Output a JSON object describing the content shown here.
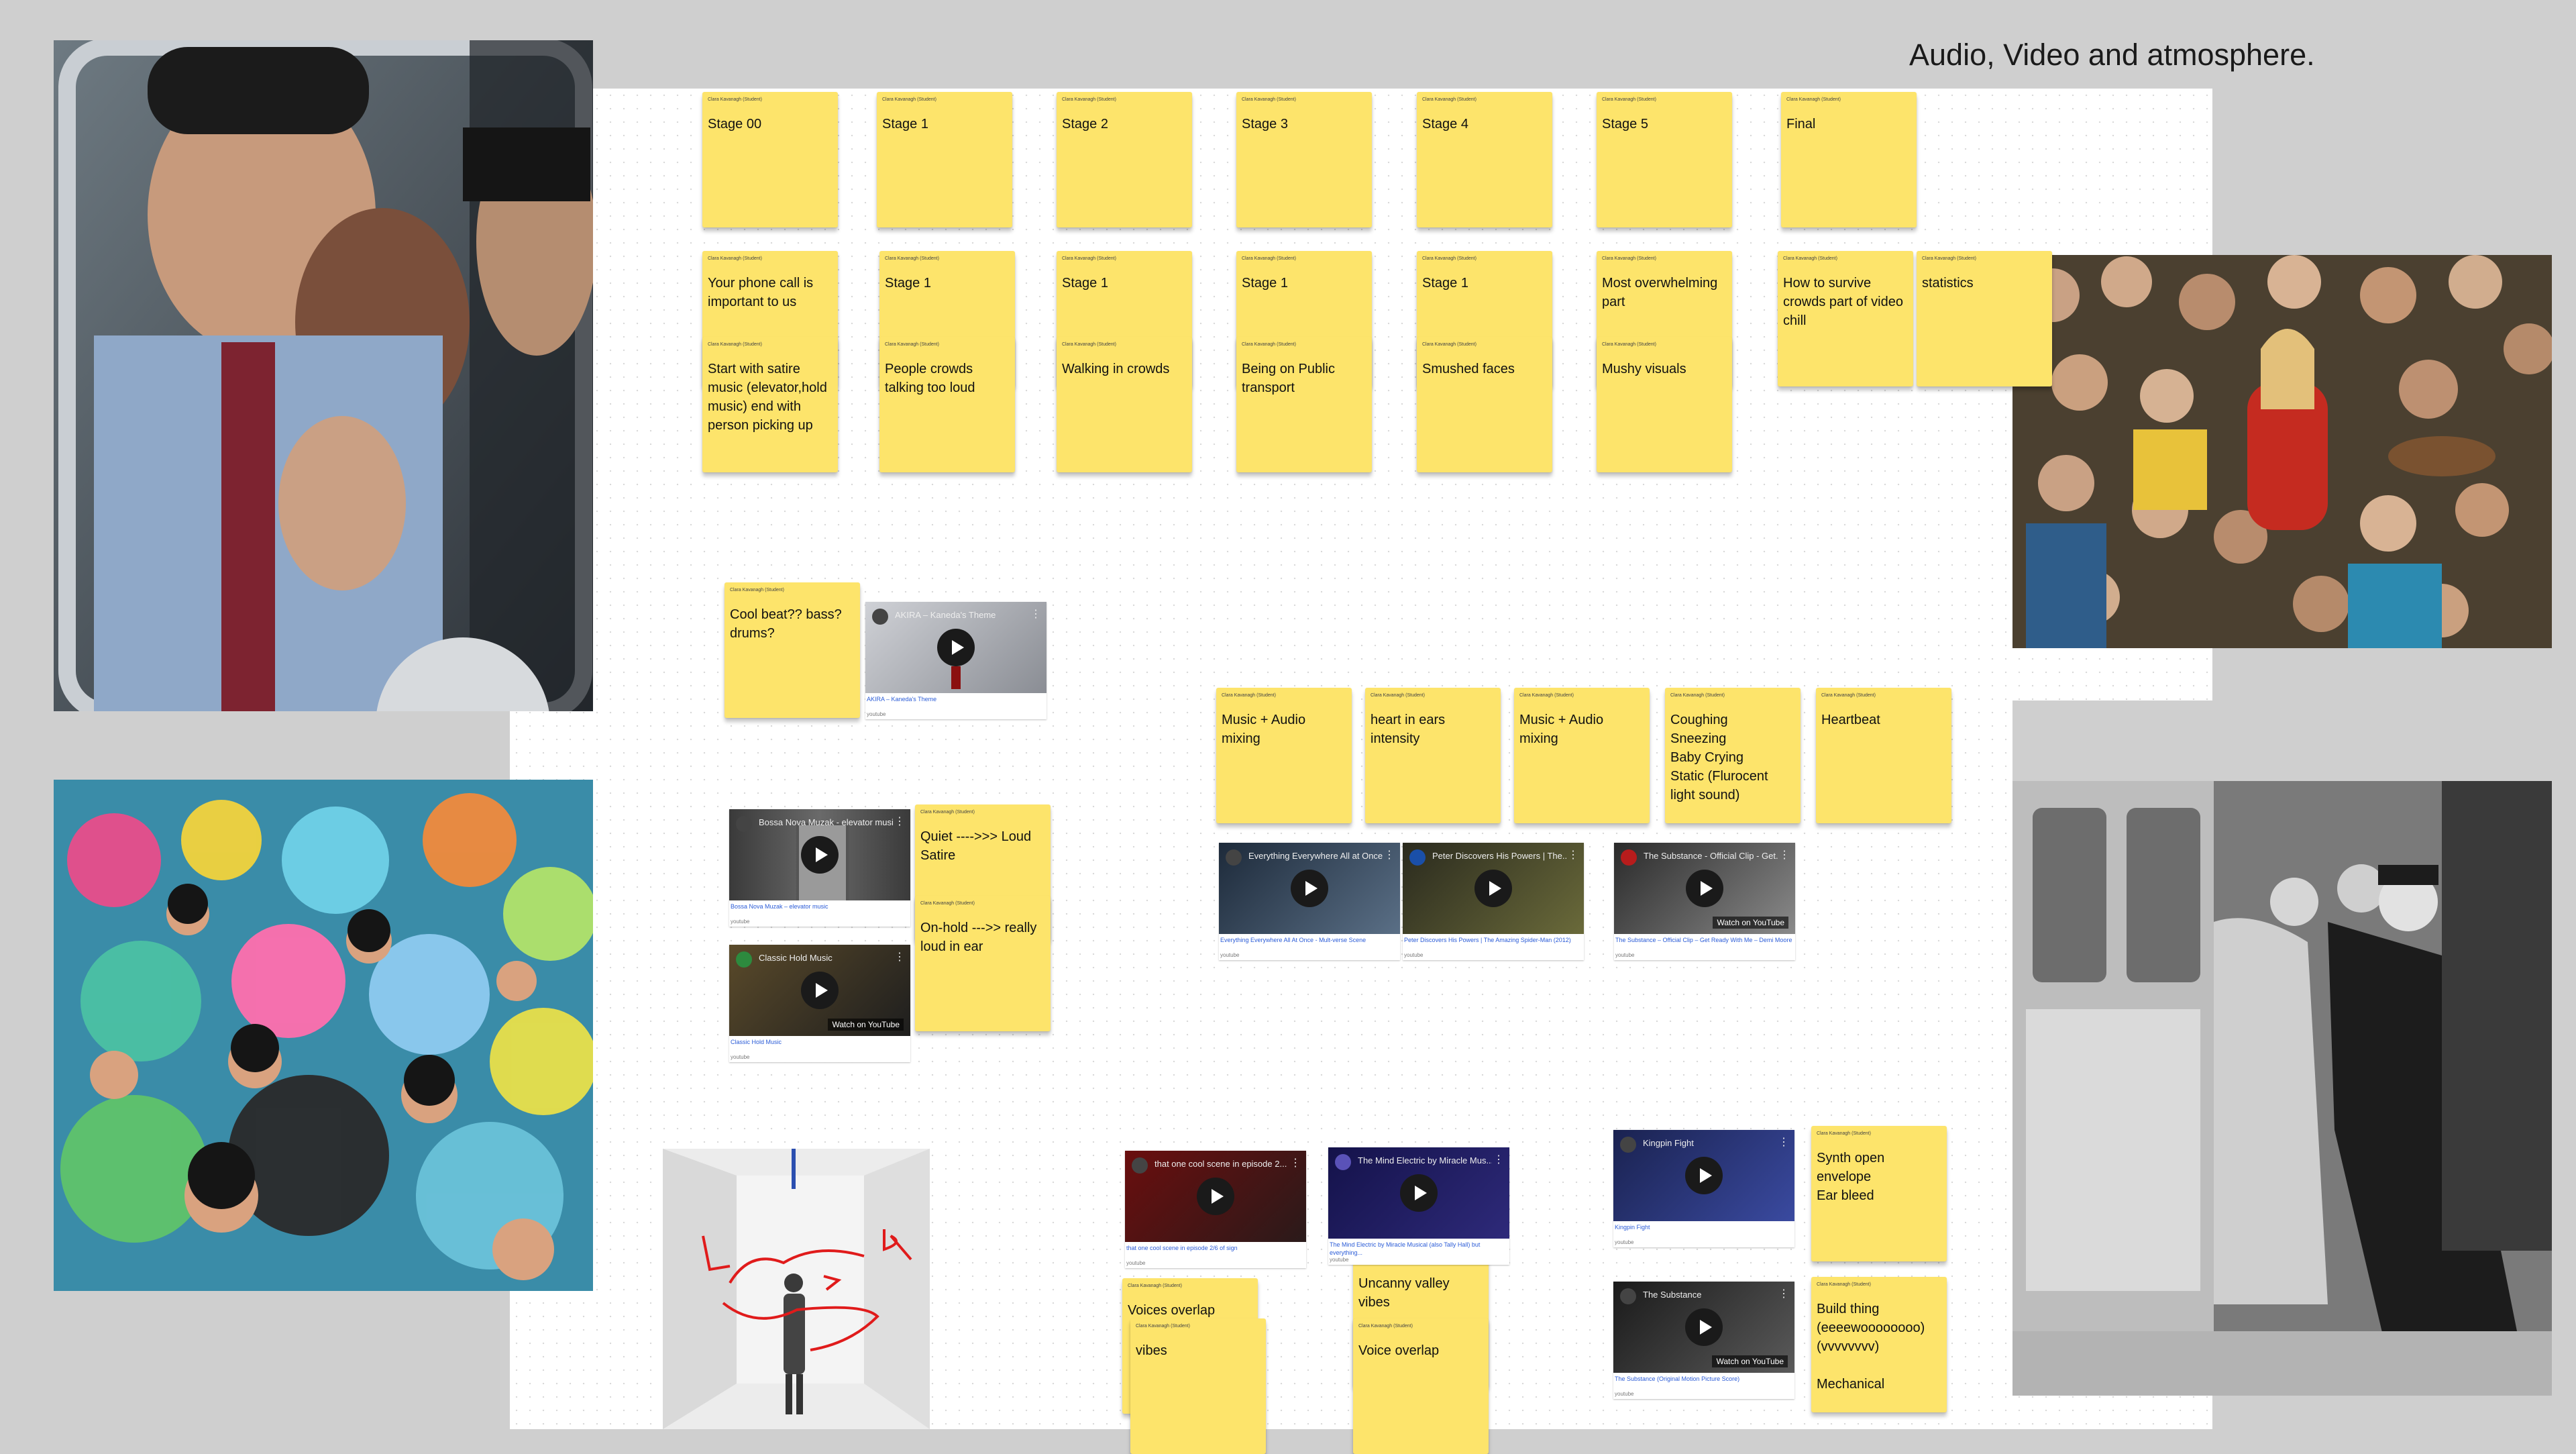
{
  "title": "Audio, Video and atmosphere.",
  "author": "Clara Kavanagh (Student)",
  "notes": [
    {
      "text": "Stage 00"
    },
    {
      "text": "Stage 1"
    },
    {
      "text": "Stage 2"
    },
    {
      "text": "Stage 3"
    },
    {
      "text": "Stage 4"
    },
    {
      "text": "Stage 5"
    },
    {
      "text": "Final"
    },
    {
      "text": "Your phone call is important to us"
    },
    {
      "text": "Stage 1"
    },
    {
      "text": "Stage 1"
    },
    {
      "text": "Stage 1"
    },
    {
      "text": "Stage 1"
    },
    {
      "text": "Most overwhelming part"
    },
    {
      "text": "How to survive crowds part of video chill"
    },
    {
      "text": "statistics"
    },
    {
      "text": "Start with satire music (elevator,hold music) end with person picking up"
    },
    {
      "text": "People crowds talking too loud"
    },
    {
      "text": "Walking in crowds"
    },
    {
      "text": "Being on Public transport"
    },
    {
      "text": "Smushed faces"
    },
    {
      "text": "Mushy visuals"
    },
    {
      "text": "Cool beat?? bass? drums?"
    },
    {
      "text": "Music + Audio mixing"
    },
    {
      "text": "heart in ears intensity"
    },
    {
      "text": "Music + Audio mixing"
    },
    {
      "text": "Coughing\nSneezing\nBaby Crying\nStatic (Flurocent light sound)"
    },
    {
      "text": "Heartbeat"
    },
    {
      "text": "Quiet ---->>> Loud Satire"
    },
    {
      "text": "On-hold --->> really loud in ear"
    },
    {
      "text": "Synth open envelope\nEar bleed"
    },
    {
      "text": "Build thing (eeeewoooooooo) (vvvvvvvv)\n\nMechanical"
    },
    {
      "text": "Uncanny valley vibes"
    },
    {
      "text": "Voice overlap"
    },
    {
      "text": "Voices overlap"
    },
    {
      "text": "vibes"
    }
  ],
  "videos": [
    {
      "title": "AKIRA – Kaneda's Theme",
      "caption": "AKIRA – Kaneda's Theme",
      "source": "youtube",
      "badge": ""
    },
    {
      "title": "Bossa Nova Muzak - elevator music",
      "caption": "Bossa Nova Muzak – elevator music",
      "source": "youtube",
      "badge": ""
    },
    {
      "title": "Classic Hold Music",
      "caption": "Classic Hold Music",
      "source": "youtube",
      "badge": "Watch on YouTube"
    },
    {
      "title": "Everything Everywhere All at Once",
      "caption": "Everything Everywhere All At Once - Mult-verse Scene",
      "source": "youtube",
      "badge": ""
    },
    {
      "title": "Peter Discovers His Powers | The...",
      "caption": "Peter Discovers His Powers | The Amazing Spider-Man (2012)",
      "source": "youtube",
      "badge": ""
    },
    {
      "title": "The Substance - Official Clip - Get...",
      "caption": "The Substance – Official Clip – Get Ready With Me – Demi Moore",
      "source": "youtube",
      "badge": "Watch on YouTube"
    },
    {
      "title": "that one cool scene in episode 2...",
      "caption": "that one cool scene in episode 2/6 of sign",
      "source": "youtube",
      "badge": ""
    },
    {
      "title": "The Mind Electric by Miracle Mus...",
      "caption": "The Mind Electric by Miracle Musical (also Tally Hall) but everything...",
      "source": "youtube",
      "badge": ""
    },
    {
      "title": "Kingpin Fight",
      "caption": "Kingpin Fight",
      "source": "youtube",
      "badge": ""
    },
    {
      "title": "The Substance",
      "caption": "The Substance (Original Motion Picture Score)",
      "source": "youtube",
      "badge": "Watch on YouTube"
    }
  ],
  "photos": {
    "subway_window": "Commuter pressed against wet train window",
    "pool": "Crowded pool with inflatable rings",
    "crowd": "Overhead view of a dense crowd of people",
    "train_pusher": "Black and white photo of station attendant pushing passengers into a train",
    "room_sketch": "White room with hanging cable, person and red annotation",
    "sketch_letters": [
      "L",
      "R",
      "S"
    ]
  },
  "colors": {
    "sticky": "#fde46b",
    "background": "#cfcfcf",
    "board": "#ffffff",
    "link": "#2a5bd7",
    "annotation": "#e01b1b"
  }
}
